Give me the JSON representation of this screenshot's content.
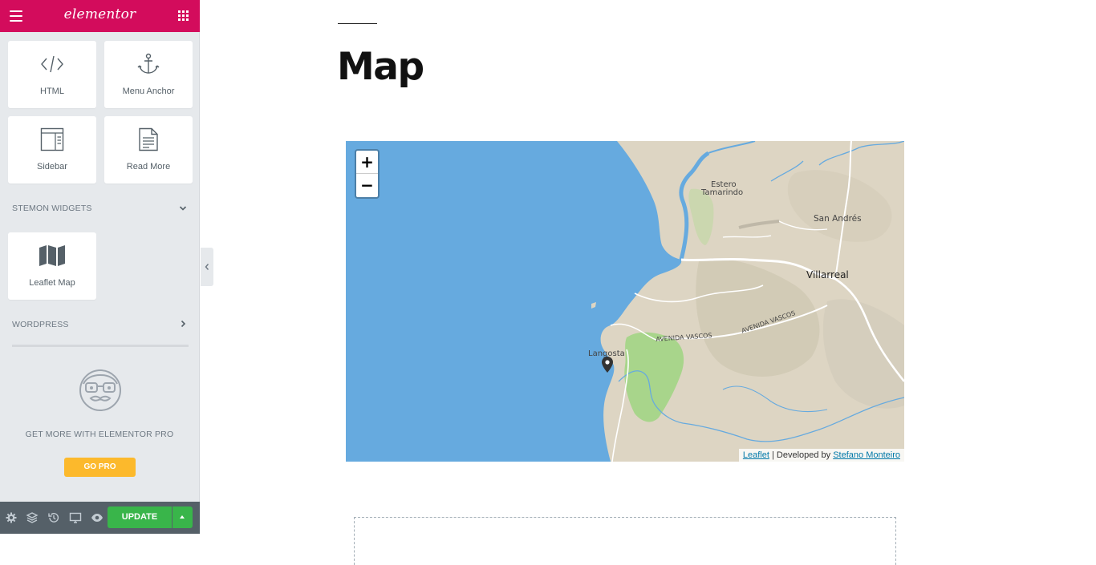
{
  "header": {
    "logo": "elementor"
  },
  "widgets": [
    {
      "label": "HTML",
      "icon": "code-icon"
    },
    {
      "label": "Menu Anchor",
      "icon": "anchor-icon"
    },
    {
      "label": "Sidebar",
      "icon": "sidebar-layout-icon"
    },
    {
      "label": "Read More",
      "icon": "document-icon"
    }
  ],
  "categories": {
    "stemon": {
      "label": "STEMON WIDGETS",
      "expanded": true
    },
    "wordpress": {
      "label": "WORDPRESS",
      "expanded": false
    }
  },
  "stemon_widgets": [
    {
      "label": "Leaflet Map",
      "icon": "map-icon"
    }
  ],
  "promo": {
    "text": "GET MORE WITH ELEMENTOR PRO",
    "button": "GO PRO"
  },
  "footer": {
    "update_label": "UPDATE"
  },
  "page": {
    "title": "Map"
  },
  "map": {
    "zoom_in": "+",
    "zoom_out": "−",
    "labels": {
      "estero_1": "Estero",
      "estero_2": "Tamarindo",
      "san_andres": "San Andrés",
      "villarreal": "Villarreal",
      "avenida_vascos_1": "AVENIDA VASCOS",
      "avenida_vascos_2": "AVENIDA VASCOS",
      "langosta": "Langosta"
    },
    "attribution": {
      "leaflet_link": "Leaflet",
      "text": " | Developed by ",
      "author_link": "Stefano Monteiro"
    }
  },
  "colors": {
    "brand": "#d30c5c",
    "update": "#39b54a",
    "go_pro": "#fcb92c",
    "water": "#66aadf",
    "land": "#ddd5c3",
    "park": "#a8d58b"
  }
}
